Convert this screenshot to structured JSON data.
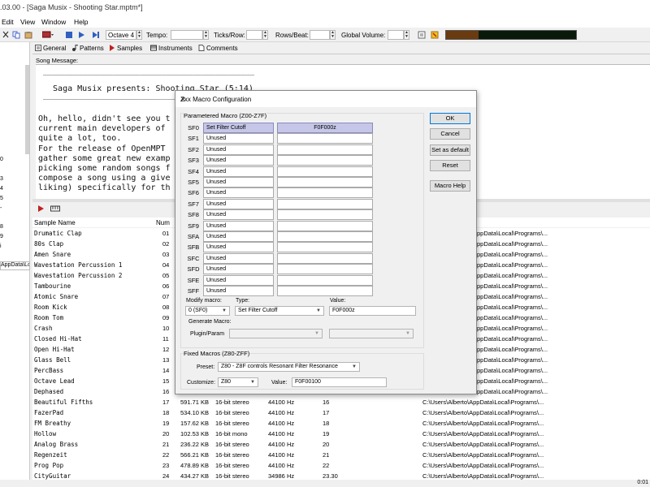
{
  "window": {
    "title": ".03.00 - [Saga Musix - Shooting Star.mptm*]"
  },
  "menu": [
    "Edit",
    "View",
    "Window",
    "Help"
  ],
  "toolbar": {
    "octave": "Octave 4",
    "tempo_label": "Tempo:",
    "ticks_label": "Ticks/Row:",
    "rows_label": "Rows/Beat:",
    "volume_label": "Global Volume:"
  },
  "tree_labels": [
    "0",
    "3",
    "4",
    "5",
    "-",
    "8",
    "9",
    "i"
  ],
  "tree_path": "AppData\\Lo",
  "tabs": [
    "General",
    "Patterns",
    "Samples",
    "Instruments",
    "Comments"
  ],
  "comments": {
    "label": "Song Message:",
    "box_top": "________________________________________________",
    "box_title": "  Saga Musix presents: Shooting Star (5:14)",
    "box_bottom": "________________________________________________",
    "lines": [
      "Oh, hello, didn't see you t",
      "current main developers of ",
      "quite a lot, too.",
      "For the release of OpenMPT ",
      "gather some great new examp",
      "picking some random songs f",
      "compose a song using a give",
      "liking) specifically for th"
    ]
  },
  "samples": {
    "headers": {
      "name": "Sample Name",
      "num": "Num"
    },
    "rows": [
      {
        "name": "Drumatic Clap",
        "num": "01"
      },
      {
        "name": "80s Clap",
        "num": "02"
      },
      {
        "name": "Amen Snare",
        "num": "03"
      },
      {
        "name": "Wavestation Percussion 1",
        "num": "04"
      },
      {
        "name": "Wavestation Percussion 2",
        "num": "05"
      },
      {
        "name": "Tambourine",
        "num": "06"
      },
      {
        "name": "Atomic Snare",
        "num": "07"
      },
      {
        "name": "Room Kick",
        "num": "08"
      },
      {
        "name": "Room Tom",
        "num": "09"
      },
      {
        "name": "Crash",
        "num": "10"
      },
      {
        "name": "Closed Hi-Hat",
        "num": "11"
      },
      {
        "name": "Open Hi-Hat",
        "num": "12"
      },
      {
        "name": "Glass Bell",
        "num": "13"
      },
      {
        "name": "PercBass",
        "num": "14"
      },
      {
        "name": "Octave Lead",
        "num": "15"
      },
      {
        "name": "Dephased",
        "num": "16"
      },
      {
        "name": "Beautiful Fifths",
        "num": "17",
        "size": "591.71 KB",
        "type": "16-bit stereo",
        "rate": "44100 Hz",
        "col": "16",
        "path": "C:\\Users\\Alberto\\AppData\\Local\\Programs\\..."
      },
      {
        "name": "FazerPad",
        "num": "18",
        "size": "534.10 KB",
        "type": "16-bit stereo",
        "rate": "44100 Hz",
        "col": "17",
        "path": "C:\\Users\\Alberto\\AppData\\Local\\Programs\\..."
      },
      {
        "name": "FM Breathy",
        "num": "19",
        "size": "157.62 KB",
        "type": "16-bit stereo",
        "rate": "44100 Hz",
        "col": "18",
        "path": "C:\\Users\\Alberto\\AppData\\Local\\Programs\\..."
      },
      {
        "name": "Hollow",
        "num": "20",
        "size": "102.53 KB",
        "type": "16-bit mono",
        "rate": "44100 Hz",
        "col": "19",
        "path": "C:\\Users\\Alberto\\AppData\\Local\\Programs\\..."
      },
      {
        "name": "Analog Brass",
        "num": "21",
        "size": "236.22 KB",
        "type": "16-bit stereo",
        "rate": "44100 Hz",
        "col": "20",
        "path": "C:\\Users\\Alberto\\AppData\\Local\\Programs\\..."
      },
      {
        "name": "Regenzeit",
        "num": "22",
        "size": "566.21 KB",
        "type": "16-bit stereo",
        "rate": "44100 Hz",
        "col": "21",
        "path": "C:\\Users\\Alberto\\AppData\\Local\\Programs\\..."
      },
      {
        "name": "Prog Pop",
        "num": "23",
        "size": "478.89 KB",
        "type": "16-bit stereo",
        "rate": "44100 Hz",
        "col": "22",
        "path": "C:\\Users\\Alberto\\AppData\\Local\\Programs\\..."
      },
      {
        "name": "CityGuitar",
        "num": "24",
        "size": "434.27 KB",
        "type": "16-bit stereo",
        "rate": "34986 Hz",
        "col": "23.30",
        "path": "C:\\Users\\Alberto\\AppData\\Local\\Programs\\..."
      }
    ],
    "hidden_paths": [
      "ppData\\Local\\Programs\\...",
      "ppData\\Local\\Programs\\...",
      "ppData\\Local\\Programs\\...",
      "ppData\\Local\\Programs\\...",
      "ppData\\Local\\Programs\\...",
      "ppData\\Local\\Programs\\...",
      "ppData\\Local\\Programs\\...",
      "ppData\\Local\\Programs\\...",
      "ppData\\Local\\Programs\\...",
      "ppData\\Local\\Programs\\...",
      "ppData\\Local\\Programs\\...",
      "ppData\\Local\\Programs\\...",
      "ppData\\Local\\Programs\\...",
      "ppData\\Local\\Programs\\...",
      "ppData\\Local\\Programs\\...",
      "ppData\\Local\\Programs\\..."
    ]
  },
  "status": {
    "time": "0:01"
  },
  "dialog": {
    "title": "Zxx Macro Configuration",
    "param_group": "Parametered Macro (Z00-Z7F)",
    "macros": [
      {
        "id": "SF0",
        "desc": "Set Filter Cutoff",
        "value": "F0F000z"
      },
      {
        "id": "SF1",
        "desc": "Unused",
        "value": ""
      },
      {
        "id": "SF2",
        "desc": "Unused",
        "value": ""
      },
      {
        "id": "SF3",
        "desc": "Unused",
        "value": ""
      },
      {
        "id": "SF4",
        "desc": "Unused",
        "value": ""
      },
      {
        "id": "SF5",
        "desc": "Unused",
        "value": ""
      },
      {
        "id": "SF6",
        "desc": "Unused",
        "value": ""
      },
      {
        "id": "SF7",
        "desc": "Unused",
        "value": ""
      },
      {
        "id": "SF8",
        "desc": "Unused",
        "value": ""
      },
      {
        "id": "SF9",
        "desc": "Unused",
        "value": ""
      },
      {
        "id": "SFA",
        "desc": "Unused",
        "value": ""
      },
      {
        "id": "SFB",
        "desc": "Unused",
        "value": ""
      },
      {
        "id": "SFC",
        "desc": "Unused",
        "value": ""
      },
      {
        "id": "SFD",
        "desc": "Unused",
        "value": ""
      },
      {
        "id": "SFE",
        "desc": "Unused",
        "value": ""
      },
      {
        "id": "SFF",
        "desc": "Unused",
        "value": ""
      }
    ],
    "modify_label": "Modify macro:",
    "modify_value": "0 (SF0)",
    "type_label": "Type:",
    "type_value": "Set Filter Cutoff",
    "value_label": "Value:",
    "value_value": "F0F000z",
    "generate_label": "Generate Macro:",
    "plugin_label": "Plugin/Param",
    "fixed_group": "Fixed Macros (Z80-ZFF)",
    "preset_label": "Preset:",
    "preset_value": "Z80 - Z8F controls Resonant Filter Resonance",
    "customize_label": "Customize:",
    "customize_value": "Z80",
    "fixed_value_label": "Value:",
    "fixed_value": "F0F00100",
    "buttons": {
      "ok": "OK",
      "cancel": "Cancel",
      "default": "Set as default",
      "reset": "Reset",
      "help": "Macro Help"
    }
  }
}
